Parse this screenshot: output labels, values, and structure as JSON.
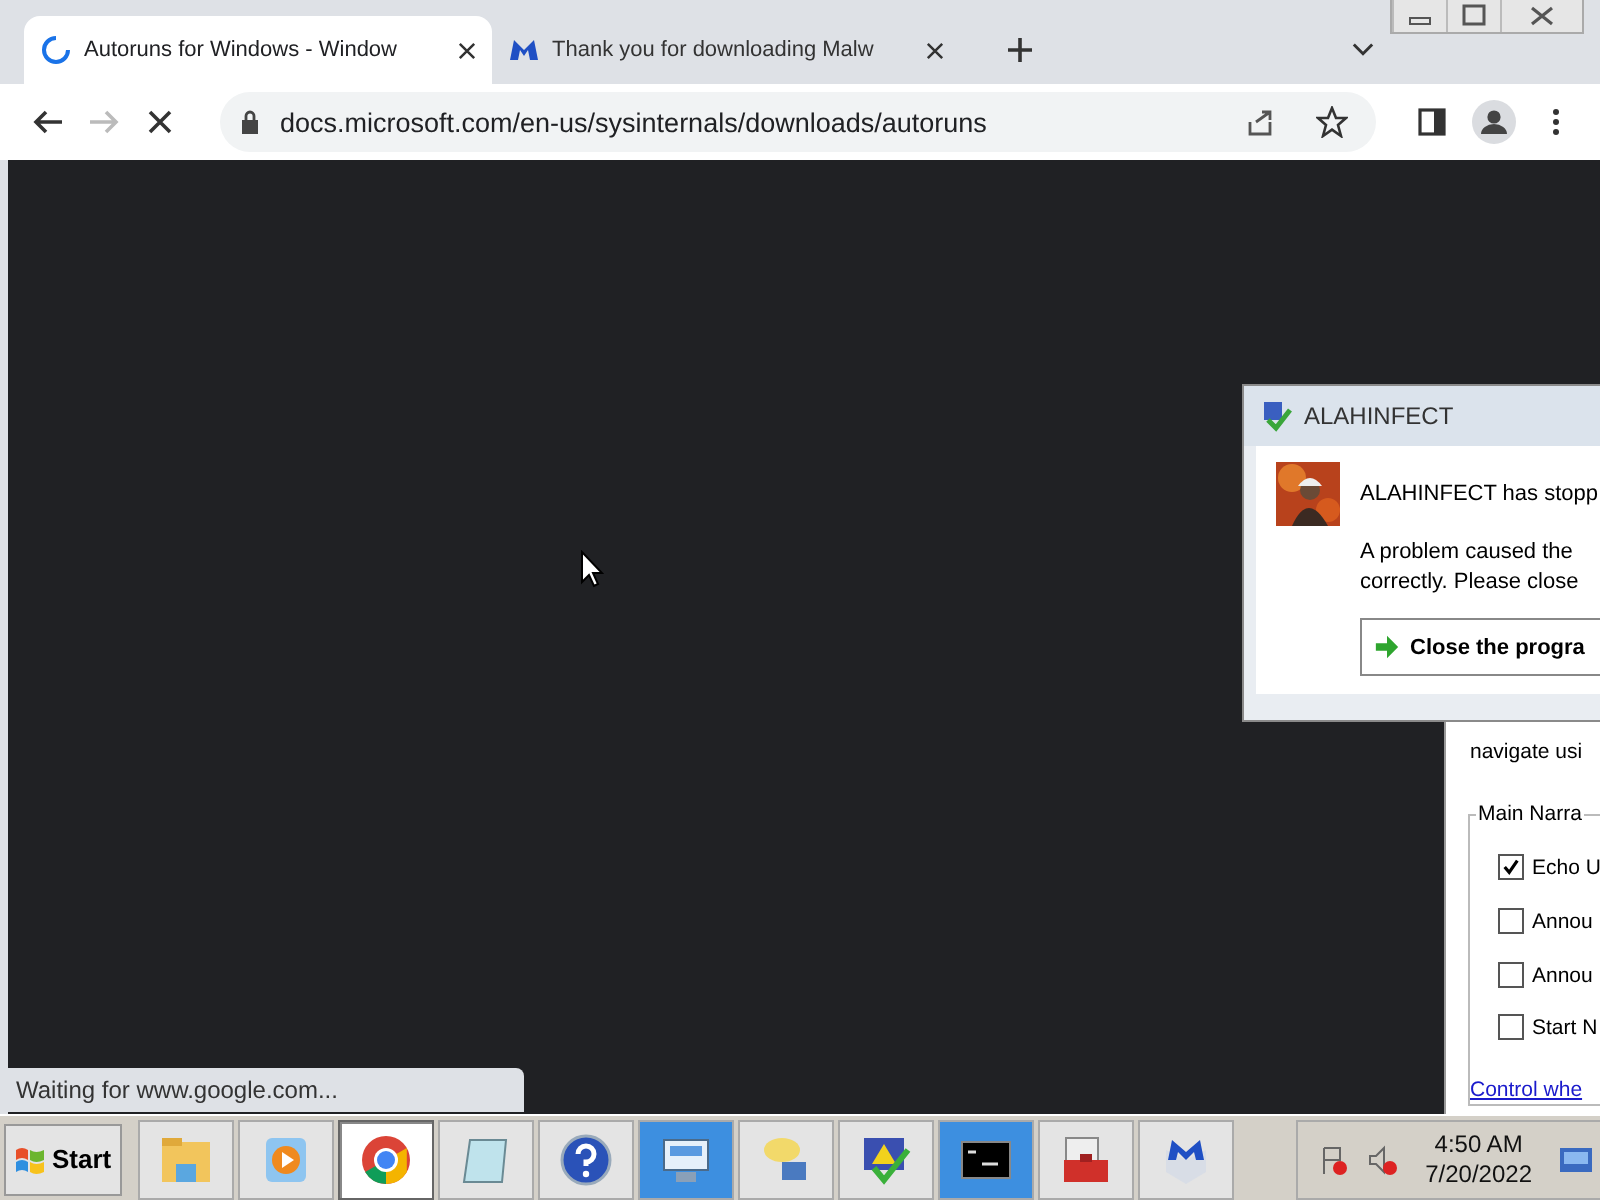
{
  "browser": {
    "tabs": [
      {
        "title": "Autoruns for Windows - Window",
        "selected": true,
        "kind": "loading"
      },
      {
        "title": "Thank you for downloading Malw",
        "selected": false,
        "kind": "malwarebytes"
      }
    ],
    "address": "docs.microsoft.com/en-us/sysinternals/downloads/autoruns",
    "loading": true,
    "status": "Waiting for www.google.com..."
  },
  "error_dialog": {
    "title": "ALAHINFECT",
    "heading": "ALAHINFECT has stopp",
    "message_lines": [
      "A problem caused the",
      "correctly. Please close"
    ],
    "button": "Close the progra"
  },
  "narrator": {
    "text": "navigate usi",
    "group": "Main Narra",
    "options": [
      {
        "label": "Echo U",
        "checked": true
      },
      {
        "label": "Annou",
        "checked": false
      },
      {
        "label": "Annou",
        "checked": false
      },
      {
        "label": "Start N",
        "checked": false
      }
    ],
    "link": "Control whe"
  },
  "taskbar": {
    "start": "Start",
    "apps": [
      {
        "kind": "folder",
        "selected": false,
        "highlighted": false
      },
      {
        "kind": "media",
        "selected": false,
        "highlighted": false
      },
      {
        "kind": "chrome",
        "selected": true,
        "highlighted": false
      },
      {
        "kind": "notepad",
        "selected": false,
        "highlighted": false
      },
      {
        "kind": "help",
        "selected": false,
        "highlighted": false
      },
      {
        "kind": "keyboard",
        "selected": false,
        "highlighted": true
      },
      {
        "kind": "chat",
        "selected": false,
        "highlighted": false
      },
      {
        "kind": "shield",
        "selected": false,
        "highlighted": false
      },
      {
        "kind": "console",
        "selected": false,
        "highlighted": true
      },
      {
        "kind": "toolbox",
        "selected": false,
        "highlighted": false
      },
      {
        "kind": "malwarebytes",
        "selected": false,
        "highlighted": false
      }
    ],
    "time": "4:50 AM",
    "date": "7/20/2022"
  }
}
